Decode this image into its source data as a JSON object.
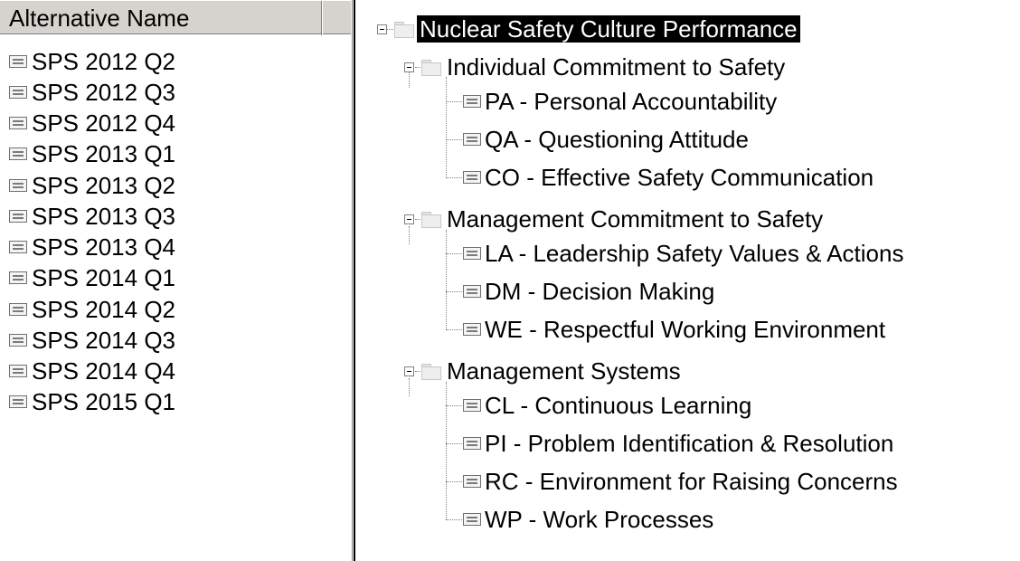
{
  "list": {
    "header": "Alternative Name",
    "items": [
      "SPS 2012 Q2",
      "SPS 2012 Q3",
      "SPS 2012 Q4",
      "SPS 2013 Q1",
      "SPS 2013 Q2",
      "SPS 2013 Q3",
      "SPS 2013 Q4",
      "SPS 2014 Q1",
      "SPS 2014 Q2",
      "SPS 2014 Q3",
      "SPS 2014 Q4",
      "SPS 2015 Q1"
    ]
  },
  "tree": {
    "root": "Nuclear Safety Culture Performance",
    "groups": [
      {
        "label": "Individual Commitment to Safety",
        "children": [
          "PA - Personal Accountability",
          "QA - Questioning Attitude",
          "CO - Effective Safety Communication"
        ]
      },
      {
        "label": "Management Commitment to Safety",
        "children": [
          "LA - Leadership Safety Values & Actions",
          "DM - Decision Making",
          "WE - Respectful Working Environment"
        ]
      },
      {
        "label": "Management Systems",
        "children": [
          "CL - Continuous Learning",
          "PI - Problem Identification & Resolution",
          "RC - Environment for Raising Concerns",
          "WP - Work Processes"
        ]
      }
    ]
  }
}
